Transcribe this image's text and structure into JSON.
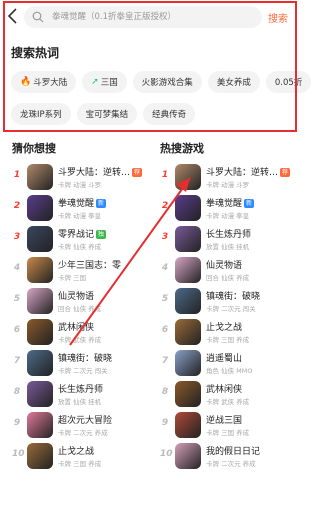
{
  "search": {
    "back_label": "back",
    "placeholder": "拳魂觉醒（0.1折拳皇正版授权）",
    "button_label": "搜索"
  },
  "hot_search": {
    "title": "搜索热词",
    "tags_row1": [
      {
        "label": "斗罗大陆",
        "icon": "fire-icon"
      },
      {
        "label": "三国",
        "icon": "trend-up-icon"
      },
      {
        "label": "火影游戏合集",
        "icon": ""
      },
      {
        "label": "美女养成",
        "icon": ""
      },
      {
        "label": "0.05折",
        "icon": ""
      }
    ],
    "tags_row2": [
      {
        "label": "龙珠IP系列"
      },
      {
        "label": "宝可梦集结"
      },
      {
        "label": "经典传奇"
      }
    ]
  },
  "guess": {
    "title": "猜你想搜",
    "items": [
      {
        "rank": "1",
        "name": "斗罗大陆：逆转…",
        "sub": "卡牌 动漫 斗罗",
        "badge": "荐",
        "badge_type": "hot",
        "color": "#b08a6a"
      },
      {
        "rank": "2",
        "name": "拳魂觉醒",
        "sub": "卡牌 动漫 拳皇",
        "badge": "新",
        "badge_type": "new",
        "color": "#5a3d8c"
      },
      {
        "rank": "3",
        "name": "零界战记",
        "sub": "卡牌 仙侠 养成",
        "badge": "独",
        "badge_type": "vip",
        "color": "#3a4660"
      },
      {
        "rank": "4",
        "name": "少年三国志：零",
        "sub": "卡牌 三国",
        "badge": "",
        "badge_type": "",
        "color": "#c98a4a"
      },
      {
        "rank": "5",
        "name": "仙灵物语",
        "sub": "回合 仙侠 养成",
        "badge": "",
        "badge_type": "",
        "color": "#d7a6c6"
      },
      {
        "rank": "6",
        "name": "武林闲侠",
        "sub": "卡牌 武侠 养成",
        "badge": "",
        "badge_type": "",
        "color": "#8a5a2a"
      },
      {
        "rank": "7",
        "name": "镇魂街：破晓",
        "sub": "卡牌 二次元 闯关",
        "badge": "",
        "badge_type": "",
        "color": "#4c6b8a"
      },
      {
        "rank": "8",
        "name": "长生炼丹师",
        "sub": "放置 仙侠 挂机",
        "badge": "",
        "badge_type": "",
        "color": "#7a5a9a"
      },
      {
        "rank": "9",
        "name": "超次元大冒险",
        "sub": "卡牌 二次元 养成",
        "badge": "",
        "badge_type": "",
        "color": "#e07a9a"
      },
      {
        "rank": "10",
        "name": "止戈之战",
        "sub": "卡牌 三国 养成",
        "badge": "",
        "badge_type": "",
        "color": "#9a6a3a"
      }
    ]
  },
  "hot_games": {
    "title": "热搜游戏",
    "items": [
      {
        "rank": "1",
        "name": "斗罗大陆：逆转…",
        "sub": "卡牌 动漫 斗罗",
        "badge": "荐",
        "badge_type": "hot",
        "color": "#b08a6a"
      },
      {
        "rank": "2",
        "name": "拳魂觉醒",
        "sub": "卡牌 动漫 拳皇",
        "badge": "新",
        "badge_type": "new",
        "color": "#5a3d8c"
      },
      {
        "rank": "3",
        "name": "长生炼丹师",
        "sub": "放置 仙侠 挂机",
        "badge": "",
        "badge_type": "",
        "color": "#7a5a9a"
      },
      {
        "rank": "4",
        "name": "仙灵物语",
        "sub": "回合 仙侠 养成",
        "badge": "",
        "badge_type": "",
        "color": "#d7a6c6"
      },
      {
        "rank": "5",
        "name": "镇魂街：破晓",
        "sub": "卡牌 二次元 闯关",
        "badge": "",
        "badge_type": "",
        "color": "#4c6b8a"
      },
      {
        "rank": "6",
        "name": "止戈之战",
        "sub": "卡牌 三国 养成",
        "badge": "",
        "badge_type": "",
        "color": "#9a6a3a"
      },
      {
        "rank": "7",
        "name": "逍遥蜀山",
        "sub": "角色 仙侠 MMO",
        "badge": "",
        "badge_type": "",
        "color": "#8aa0c8"
      },
      {
        "rank": "8",
        "name": "武林闲侠",
        "sub": "卡牌 武侠 养成",
        "badge": "",
        "badge_type": "",
        "color": "#8a5a2a"
      },
      {
        "rank": "9",
        "name": "逆战三国",
        "sub": "卡牌 三国 养成",
        "badge": "",
        "badge_type": "",
        "color": "#b04a3a"
      },
      {
        "rank": "10",
        "name": "我的假日日记",
        "sub": "卡牌 二次元 养成",
        "badge": "",
        "badge_type": "",
        "color": "#d4a0b8"
      }
    ]
  },
  "colors": {
    "accent": "#ff6a3d",
    "rank_top": "#ff3b30",
    "highlight": "#e62e2e"
  }
}
